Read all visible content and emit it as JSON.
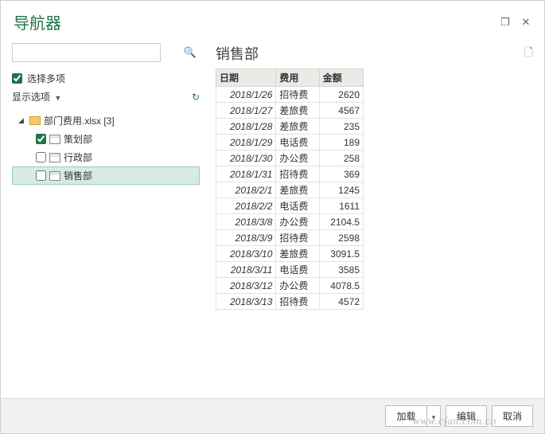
{
  "window": {
    "title": "导航器"
  },
  "left": {
    "search_placeholder": "",
    "select_multiple": "选择多项",
    "display_options": "显示选项",
    "tree": {
      "file": "部门费用.xlsx [3]",
      "items": [
        {
          "label": "策划部",
          "checked": true,
          "selected": false
        },
        {
          "label": "行政部",
          "checked": false,
          "selected": false
        },
        {
          "label": "销售部",
          "checked": false,
          "selected": true
        }
      ]
    }
  },
  "preview": {
    "title": "销售部",
    "columns": [
      "日期",
      "费用",
      "金额"
    ],
    "rows": [
      {
        "date": "2018/1/26",
        "type": "招待费",
        "amount": "2620"
      },
      {
        "date": "2018/1/27",
        "type": "差旅费",
        "amount": "4567"
      },
      {
        "date": "2018/1/28",
        "type": "差旅费",
        "amount": "235"
      },
      {
        "date": "2018/1/29",
        "type": "电话费",
        "amount": "189"
      },
      {
        "date": "2018/1/30",
        "type": "办公费",
        "amount": "258"
      },
      {
        "date": "2018/1/31",
        "type": "招待费",
        "amount": "369"
      },
      {
        "date": "2018/2/1",
        "type": "差旅费",
        "amount": "1245"
      },
      {
        "date": "2018/2/2",
        "type": "电话费",
        "amount": "1611"
      },
      {
        "date": "2018/3/8",
        "type": "办公费",
        "amount": "2104.5"
      },
      {
        "date": "2018/3/9",
        "type": "招待费",
        "amount": "2598"
      },
      {
        "date": "2018/3/10",
        "type": "差旅费",
        "amount": "3091.5"
      },
      {
        "date": "2018/3/11",
        "type": "电话费",
        "amount": "3585"
      },
      {
        "date": "2018/3/12",
        "type": "办公费",
        "amount": "4078.5"
      },
      {
        "date": "2018/3/13",
        "type": "招待费",
        "amount": "4572"
      }
    ]
  },
  "footer": {
    "load": "加载",
    "edit": "编辑",
    "cancel": "取消"
  },
  "watermark": "www.cfan.com.cn"
}
